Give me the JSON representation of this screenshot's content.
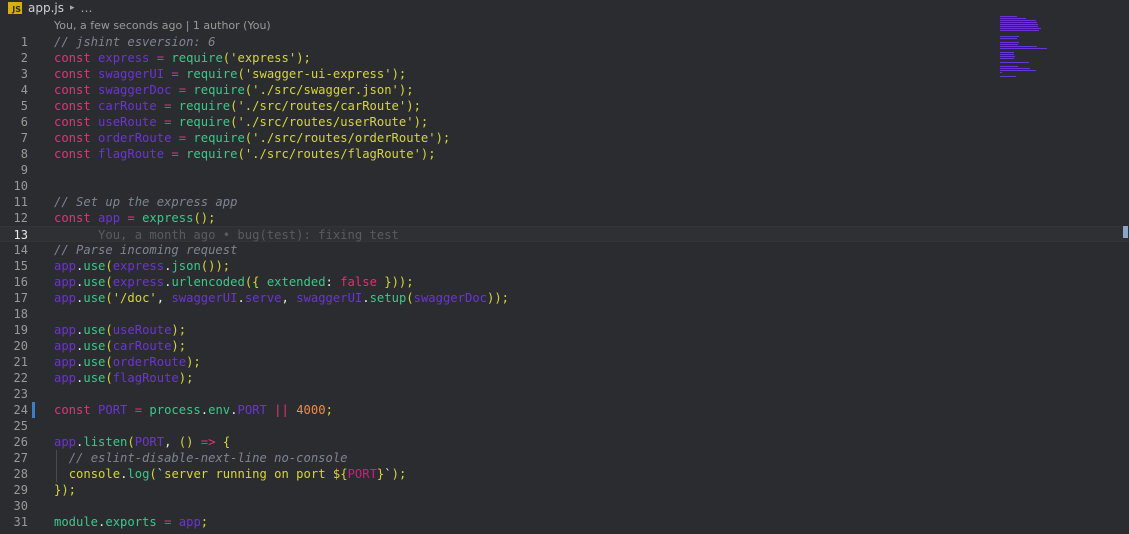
{
  "breadcrumb": {
    "file_icon": "JS",
    "file": "app.js",
    "separator": "▸",
    "more": "…"
  },
  "codelens": "You, a few seconds ago | 1 author (You)",
  "blame_inline": "You, a month ago • bug(test): fixing test",
  "current_line": 13,
  "lines": [
    {
      "n": "1",
      "tokens": [
        [
          "cm",
          "// jshint esversion: 6"
        ]
      ]
    },
    {
      "n": "2",
      "tokens": [
        [
          "kw",
          "const "
        ],
        [
          "var",
          "express"
        ],
        [
          "kw",
          " = "
        ],
        [
          "fn",
          "require"
        ],
        [
          "pun",
          "("
        ],
        [
          "str",
          "'express'"
        ],
        [
          "pun",
          ");"
        ]
      ]
    },
    {
      "n": "3",
      "tokens": [
        [
          "kw",
          "const "
        ],
        [
          "var",
          "swaggerUI"
        ],
        [
          "kw",
          " = "
        ],
        [
          "fn",
          "require"
        ],
        [
          "pun",
          "("
        ],
        [
          "str",
          "'swagger-ui-express'"
        ],
        [
          "pun",
          ");"
        ]
      ]
    },
    {
      "n": "4",
      "tokens": [
        [
          "kw",
          "const "
        ],
        [
          "var",
          "swaggerDoc"
        ],
        [
          "kw",
          " = "
        ],
        [
          "fn",
          "require"
        ],
        [
          "pun",
          "("
        ],
        [
          "str",
          "'./src/swagger.json'"
        ],
        [
          "pun",
          ");"
        ]
      ]
    },
    {
      "n": "5",
      "tokens": [
        [
          "kw",
          "const "
        ],
        [
          "var",
          "carRoute"
        ],
        [
          "kw",
          " = "
        ],
        [
          "fn",
          "require"
        ],
        [
          "pun",
          "("
        ],
        [
          "str",
          "'./src/routes/carRoute'"
        ],
        [
          "pun",
          ");"
        ]
      ]
    },
    {
      "n": "6",
      "tokens": [
        [
          "kw",
          "const "
        ],
        [
          "var",
          "useRoute"
        ],
        [
          "kw",
          " = "
        ],
        [
          "fn",
          "require"
        ],
        [
          "pun",
          "("
        ],
        [
          "str",
          "'./src/routes/userRoute'"
        ],
        [
          "pun",
          ");"
        ]
      ]
    },
    {
      "n": "7",
      "tokens": [
        [
          "kw",
          "const "
        ],
        [
          "var",
          "orderRoute"
        ],
        [
          "kw",
          " = "
        ],
        [
          "fn",
          "require"
        ],
        [
          "pun",
          "("
        ],
        [
          "str",
          "'./src/routes/orderRoute'"
        ],
        [
          "pun",
          ");"
        ]
      ]
    },
    {
      "n": "8",
      "tokens": [
        [
          "kw",
          "const "
        ],
        [
          "var",
          "flagRoute"
        ],
        [
          "kw",
          " = "
        ],
        [
          "fn",
          "require"
        ],
        [
          "pun",
          "("
        ],
        [
          "str",
          "'./src/routes/flagRoute'"
        ],
        [
          "pun",
          ");"
        ]
      ]
    },
    {
      "n": "9",
      "tokens": []
    },
    {
      "n": "10",
      "tokens": []
    },
    {
      "n": "11",
      "tokens": [
        [
          "cm",
          "// Set up the express app"
        ]
      ]
    },
    {
      "n": "12",
      "tokens": [
        [
          "kw",
          "const "
        ],
        [
          "var",
          "app"
        ],
        [
          "kw",
          " = "
        ],
        [
          "fn",
          "express"
        ],
        [
          "pun",
          "();"
        ]
      ]
    },
    {
      "n": "13",
      "tokens": []
    },
    {
      "n": "14",
      "tokens": [
        [
          "cm",
          "// Parse incoming request"
        ]
      ]
    },
    {
      "n": "15",
      "tokens": [
        [
          "var",
          "app"
        ],
        [
          "pl",
          "."
        ],
        [
          "fn",
          "use"
        ],
        [
          "pun",
          "("
        ],
        [
          "var",
          "express"
        ],
        [
          "pl",
          "."
        ],
        [
          "fn",
          "json"
        ],
        [
          "pun",
          "());"
        ]
      ]
    },
    {
      "n": "16",
      "tokens": [
        [
          "var",
          "app"
        ],
        [
          "pl",
          "."
        ],
        [
          "fn",
          "use"
        ],
        [
          "pun",
          "("
        ],
        [
          "var",
          "express"
        ],
        [
          "pl",
          "."
        ],
        [
          "fn",
          "urlencoded"
        ],
        [
          "pun",
          "({ "
        ],
        [
          "fn",
          "extended"
        ],
        [
          "pl",
          ": "
        ],
        [
          "kwv",
          "false"
        ],
        [
          "pun",
          " }));"
        ]
      ]
    },
    {
      "n": "17",
      "tokens": [
        [
          "var",
          "app"
        ],
        [
          "pl",
          "."
        ],
        [
          "fn",
          "use"
        ],
        [
          "pun",
          "("
        ],
        [
          "str",
          "'/doc'"
        ],
        [
          "pl",
          ", "
        ],
        [
          "var",
          "swaggerUI"
        ],
        [
          "pl",
          "."
        ],
        [
          "var",
          "serve"
        ],
        [
          "pl",
          ", "
        ],
        [
          "var",
          "swaggerUI"
        ],
        [
          "pl",
          "."
        ],
        [
          "fn",
          "setup"
        ],
        [
          "pun",
          "("
        ],
        [
          "var",
          "swaggerDoc"
        ],
        [
          "pun",
          "));"
        ]
      ]
    },
    {
      "n": "18",
      "tokens": []
    },
    {
      "n": "19",
      "tokens": [
        [
          "var",
          "app"
        ],
        [
          "pl",
          "."
        ],
        [
          "fn",
          "use"
        ],
        [
          "pun",
          "("
        ],
        [
          "var",
          "useRoute"
        ],
        [
          "pun",
          ");"
        ]
      ]
    },
    {
      "n": "20",
      "tokens": [
        [
          "var",
          "app"
        ],
        [
          "pl",
          "."
        ],
        [
          "fn",
          "use"
        ],
        [
          "pun",
          "("
        ],
        [
          "var",
          "carRoute"
        ],
        [
          "pun",
          ");"
        ]
      ]
    },
    {
      "n": "21",
      "tokens": [
        [
          "var",
          "app"
        ],
        [
          "pl",
          "."
        ],
        [
          "fn",
          "use"
        ],
        [
          "pun",
          "("
        ],
        [
          "var",
          "orderRoute"
        ],
        [
          "pun",
          ");"
        ]
      ]
    },
    {
      "n": "22",
      "tokens": [
        [
          "var",
          "app"
        ],
        [
          "pl",
          "."
        ],
        [
          "fn",
          "use"
        ],
        [
          "pun",
          "("
        ],
        [
          "var",
          "flagRoute"
        ],
        [
          "pun",
          ");"
        ]
      ]
    },
    {
      "n": "23",
      "tokens": []
    },
    {
      "n": "24",
      "tokens": [
        [
          "kw",
          "const "
        ],
        [
          "var",
          "PORT"
        ],
        [
          "kw",
          " = "
        ],
        [
          "fn",
          "process"
        ],
        [
          "pl",
          "."
        ],
        [
          "fn",
          "env"
        ],
        [
          "pl",
          "."
        ],
        [
          "var",
          "PORT"
        ],
        [
          "kw",
          " || "
        ],
        [
          "num",
          "4000"
        ],
        [
          "pun",
          ";"
        ]
      ]
    },
    {
      "n": "25",
      "tokens": []
    },
    {
      "n": "26",
      "tokens": [
        [
          "var",
          "app"
        ],
        [
          "pl",
          "."
        ],
        [
          "fn",
          "listen"
        ],
        [
          "pun",
          "("
        ],
        [
          "var",
          "PORT"
        ],
        [
          "pl",
          ", "
        ],
        [
          "pun",
          "() "
        ],
        [
          "arr",
          "=>"
        ],
        [
          "pun",
          " {"
        ]
      ]
    },
    {
      "n": "27",
      "tokens": [
        [
          "pl",
          "  "
        ],
        [
          "cm",
          "// eslint-disable-next-line no-console"
        ]
      ]
    },
    {
      "n": "28",
      "tokens": [
        [
          "pl",
          "  "
        ],
        [
          "str",
          "console"
        ],
        [
          "pl",
          "."
        ],
        [
          "fn",
          "log"
        ],
        [
          "pun",
          "("
        ],
        [
          "pl",
          "`"
        ],
        [
          "str",
          "server running on port "
        ],
        [
          "pun",
          "${"
        ],
        [
          "lit",
          "PORT"
        ],
        [
          "pun",
          "}"
        ],
        [
          "pl",
          "`"
        ],
        [
          "pun",
          ");"
        ]
      ]
    },
    {
      "n": "29",
      "tokens": [
        [
          "pun",
          "});"
        ]
      ]
    },
    {
      "n": "30",
      "tokens": []
    },
    {
      "n": "31",
      "tokens": [
        [
          "fn",
          "module"
        ],
        [
          "pl",
          "."
        ],
        [
          "fn",
          "exports"
        ],
        [
          "kw",
          " = "
        ],
        [
          "var",
          "app"
        ],
        [
          "pun",
          ";"
        ]
      ]
    }
  ],
  "git_changed_line": 24,
  "minimap_color": "#6c33d6"
}
